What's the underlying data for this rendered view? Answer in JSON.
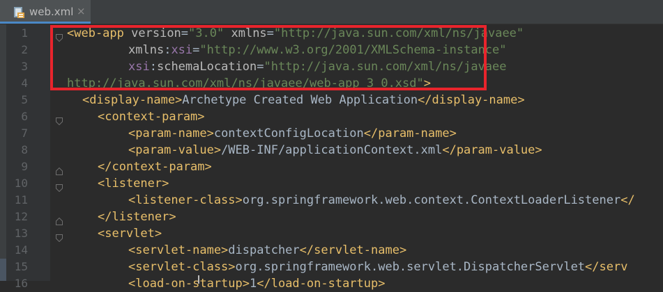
{
  "tab": {
    "label": "web.xml",
    "close": "×",
    "icon": "xml-file-icon"
  },
  "accent_color": "#4a88c7",
  "highlight_color": "#e8242c",
  "lines": [
    {
      "n": "1",
      "indent": 0,
      "fold": "open",
      "tokens": [
        {
          "c": "t",
          "v": "<web-app"
        },
        {
          "c": "p",
          "v": " "
        },
        {
          "c": "a",
          "v": "version"
        },
        {
          "c": "p",
          "v": "="
        },
        {
          "c": "s",
          "v": "\"3.0\""
        },
        {
          "c": "p",
          "v": " "
        },
        {
          "c": "a",
          "v": "xmlns"
        },
        {
          "c": "p",
          "v": "="
        },
        {
          "c": "s",
          "v": "\"http://java.sun.com/xml/ns/javaee\""
        }
      ]
    },
    {
      "n": "2",
      "indent": 4,
      "fold": "none",
      "tokens": [
        {
          "c": "a",
          "v": "xmlns"
        },
        {
          "c": "p",
          "v": ":"
        },
        {
          "c": "ns",
          "v": "xsi"
        },
        {
          "c": "p",
          "v": "="
        },
        {
          "c": "s",
          "v": "\"http://www.w3.org/2001/XMLSchema-instance\""
        }
      ]
    },
    {
      "n": "3",
      "indent": 4,
      "fold": "none",
      "tokens": [
        {
          "c": "ns",
          "v": "xsi"
        },
        {
          "c": "p",
          "v": ":"
        },
        {
          "c": "a",
          "v": "schemaLocation"
        },
        {
          "c": "p",
          "v": "="
        },
        {
          "c": "s",
          "v": "\"http://java.sun.com/xml/ns/javaee"
        }
      ]
    },
    {
      "n": "4",
      "indent": 0,
      "fold": "none",
      "tokens": [
        {
          "c": "s",
          "v": "http://java.sun.com/xml/ns/javaee/web-app_3_0.xsd\""
        },
        {
          "c": "t",
          "v": ">"
        }
      ]
    },
    {
      "n": "5",
      "indent": 1,
      "fold": "none",
      "tokens": [
        {
          "c": "t",
          "v": "<display-name>"
        },
        {
          "c": "p",
          "v": "Archetype Created Web Application"
        },
        {
          "c": "t",
          "v": "</display-name>"
        }
      ]
    },
    {
      "n": "6",
      "indent": 2,
      "fold": "open",
      "tokens": [
        {
          "c": "t",
          "v": "<context-param>"
        }
      ]
    },
    {
      "n": "7",
      "indent": 4,
      "fold": "none",
      "tokens": [
        {
          "c": "t",
          "v": "<param-name>"
        },
        {
          "c": "p",
          "v": "contextConfigLocation"
        },
        {
          "c": "t",
          "v": "</param-name>"
        }
      ]
    },
    {
      "n": "8",
      "indent": 4,
      "fold": "none",
      "tokens": [
        {
          "c": "t",
          "v": "<param-value>"
        },
        {
          "c": "p",
          "v": "/WEB-INF/applicationContext.xml"
        },
        {
          "c": "t",
          "v": "</param-value>"
        }
      ]
    },
    {
      "n": "9",
      "indent": 2,
      "fold": "close",
      "tokens": [
        {
          "c": "t",
          "v": "</context-param>"
        }
      ]
    },
    {
      "n": "10",
      "indent": 2,
      "fold": "open",
      "tokens": [
        {
          "c": "t",
          "v": "<listener>"
        }
      ]
    },
    {
      "n": "11",
      "indent": 4,
      "fold": "none",
      "tokens": [
        {
          "c": "t",
          "v": "<listener-class>"
        },
        {
          "c": "p",
          "v": "org.springframework.web.context.ContextLoaderListener"
        },
        {
          "c": "t",
          "v": "</"
        }
      ]
    },
    {
      "n": "12",
      "indent": 2,
      "fold": "close",
      "tokens": [
        {
          "c": "t",
          "v": "</listener>"
        }
      ]
    },
    {
      "n": "13",
      "indent": 2,
      "fold": "open",
      "tokens": [
        {
          "c": "t",
          "v": "<servlet>"
        }
      ]
    },
    {
      "n": "14",
      "indent": 4,
      "fold": "none",
      "tokens": [
        {
          "c": "t",
          "v": "<servlet-name>"
        },
        {
          "c": "p",
          "v": "dispatcher"
        },
        {
          "c": "t",
          "v": "</servlet-name>"
        }
      ]
    },
    {
      "n": "15",
      "indent": 4,
      "fold": "none",
      "tokens": [
        {
          "c": "t",
          "v": "<servlet-class>"
        },
        {
          "c": "p",
          "v": "org.springframework.web.servlet.DispatcherServlet"
        },
        {
          "c": "t",
          "v": "</serv"
        }
      ]
    },
    {
      "n": "16",
      "indent": 4,
      "fold": "none",
      "tokens": [
        {
          "c": "t",
          "v": "<load-on-startup>"
        },
        {
          "c": "p",
          "v": "1"
        },
        {
          "c": "t",
          "v": "</load-on-startup>"
        }
      ]
    }
  ]
}
